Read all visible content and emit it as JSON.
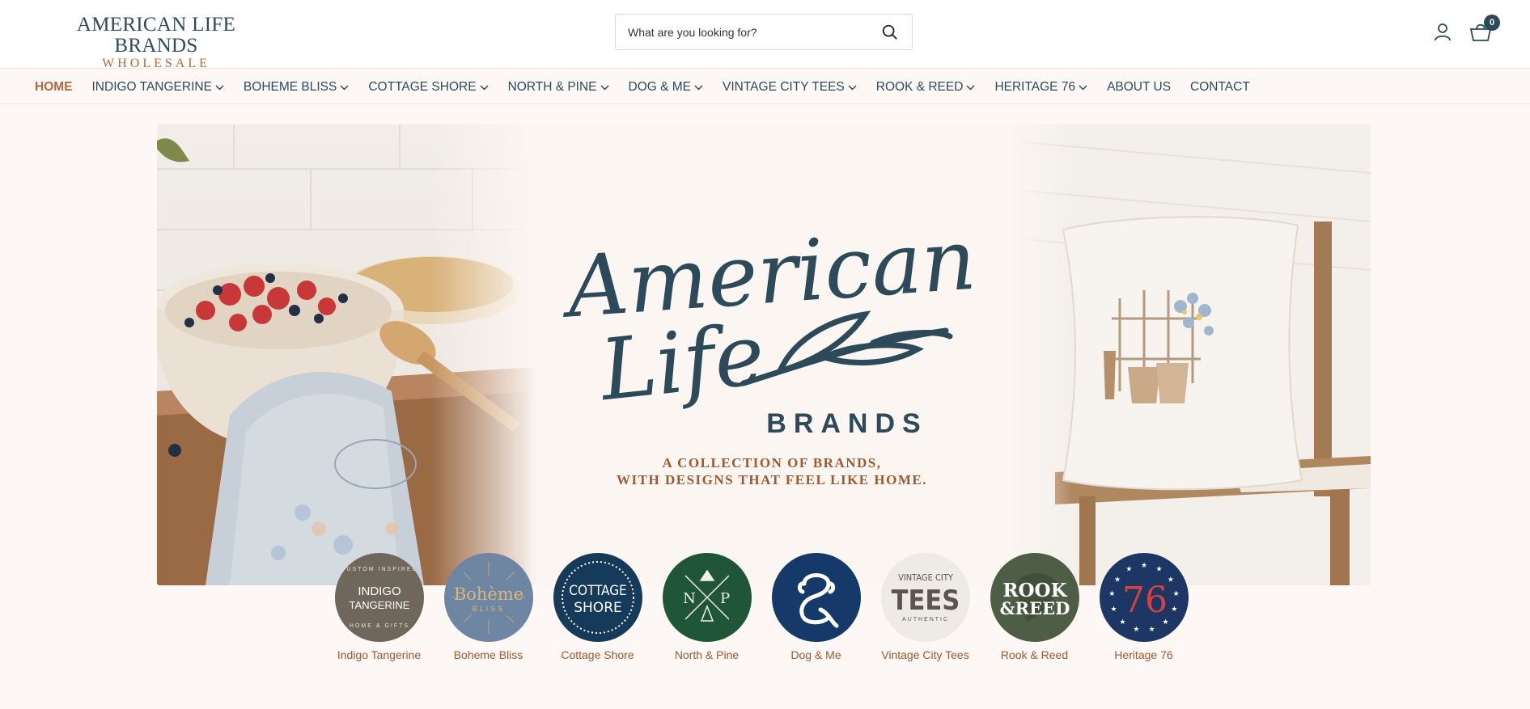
{
  "header": {
    "logo_line1": "AMERICAN LIFE BRANDS",
    "logo_line2": "WHOLESALE",
    "search_placeholder": "What are you looking for?",
    "cart_count": "0"
  },
  "nav": {
    "items": [
      {
        "label": "HOME",
        "active": true,
        "dropdown": false
      },
      {
        "label": "INDIGO TANGERINE",
        "dropdown": true
      },
      {
        "label": "BOHEME BLISS",
        "dropdown": true
      },
      {
        "label": "COTTAGE SHORE",
        "dropdown": true
      },
      {
        "label": "NORTH & PINE",
        "dropdown": true
      },
      {
        "label": "DOG & ME",
        "dropdown": true
      },
      {
        "label": "VINTAGE CITY TEES",
        "dropdown": true
      },
      {
        "label": "ROOK & REED",
        "dropdown": true
      },
      {
        "label": "HERITAGE 76",
        "dropdown": true
      },
      {
        "label": "ABOUT US",
        "dropdown": false
      },
      {
        "label": "CONTACT",
        "dropdown": false
      }
    ]
  },
  "hero": {
    "script_line1": "American",
    "script_line2": "Life",
    "brands_word": "BRANDS",
    "tagline_line1": "A COLLECTION OF BRANDS,",
    "tagline_line2": "WITH DESIGNS THAT FEEL LIKE HOME."
  },
  "brands": [
    {
      "label": "Indigo Tangerine",
      "logo_text": [
        "INDIGO",
        "TANGERINE"
      ],
      "ring_text": "CUSTOM INSPIRED",
      "ring_bottom": "HOME & GIFTS",
      "color": "#6f665c"
    },
    {
      "label": "Boheme Bliss",
      "logo_text": [
        "Bohème",
        "BLISS"
      ],
      "color": "#6f86a3"
    },
    {
      "label": "Cottage Shore",
      "logo_text": [
        "COTTAGE",
        "SHORE"
      ],
      "color": "#163a5a"
    },
    {
      "label": "North & Pine",
      "logo_text": [
        "N",
        "P"
      ],
      "color": "#1f5638"
    },
    {
      "label": "Dog & Me",
      "logo_text": [],
      "color": "#153a6a"
    },
    {
      "label": "Vintage City Tees",
      "logo_text": [
        "VINTAGE CITY",
        "TEES",
        "AUTHENTIC"
      ],
      "color": "#eeebe6"
    },
    {
      "label": "Rook & Reed",
      "logo_text": [
        "ROOK",
        "&REED"
      ],
      "color": "#4e5e46"
    },
    {
      "label": "Heritage 76",
      "logo_text": [
        "76"
      ],
      "color": "#1e3663"
    }
  ],
  "colors": {
    "primary": "#2c4a5a",
    "accent": "#b0693c",
    "background": "#fdf8f5"
  }
}
